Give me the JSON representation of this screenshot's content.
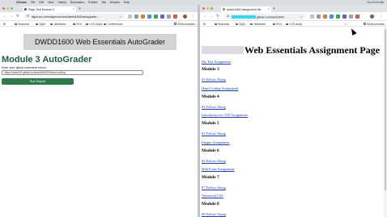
{
  "menubar": {
    "app": "Chrome",
    "items": [
      "File",
      "Edit",
      "View",
      "History",
      "Bookmarks",
      "Profiles",
      "Tab",
      "Window",
      "Help"
    ],
    "clock": "Thu 10:24 AM"
  },
  "left_browser": {
    "tab_title": "Page Test Module 3",
    "url": "dgmuvu.com/dgmcourses/dwdd1600/autograde...",
    "bookmarks": [
      "Business",
      "Sybil",
      "Validators",
      "BYU",
      "LDS study",
      "Conferences"
    ],
    "all_bookmarks": "All Bookmarks",
    "page": {
      "header": "DWDD1600 Web Essentials AutoGrader",
      "title": "Module 3 AutoGrader",
      "input_label": "Enter your github username below.",
      "input_value": "https://dwdd15.github.io/dwdd1600/03hand-coding",
      "button": "Run Report"
    }
  },
  "right_browser": {
    "tab_title": "dwdd 1600 assignment list",
    "url": "github.io/dwdd1600/",
    "bookmarks": [
      "Business",
      "Sybil",
      "Validators",
      "BYU",
      "LDS study"
    ],
    "all_bookmarks": "All Bookmarks",
    "page": {
      "title": "Web Essentials Assignment Page",
      "links": {
        "test": "My Test Assignment",
        "m3_follow": "03 Follow Along",
        "m3_assign": "Hand Coding Assignment",
        "m4_follow": "04 Follow Along",
        "m4_assign": "Introduction to CSS Assignment",
        "m5_follow": "05 Follow Along",
        "m5_assign": "Images Assignment",
        "m6_follow": "06 Follow Along",
        "m6_assign": "Web Form Assignment",
        "m7_follow": "07 Follow Along",
        "m7_assign": "Advanced CSS",
        "m8_follow": "08 Follow Along"
      },
      "headings": {
        "m3": "Module 3",
        "m4": "Module 4",
        "m5": "Module 5",
        "m6": "Module 6",
        "m7": "Module 7",
        "m8": "Module 8"
      }
    }
  },
  "icons": {
    "back": "arrow-left-icon",
    "forward": "arrow-right-icon",
    "reload": "reload-icon",
    "star": "star-icon",
    "new_tab": "plus-icon",
    "close": "close-icon"
  },
  "colors": {
    "autograder_title": "#1e5e3c",
    "run_button": "#2f7a4b",
    "link": "#1a3fb0"
  }
}
